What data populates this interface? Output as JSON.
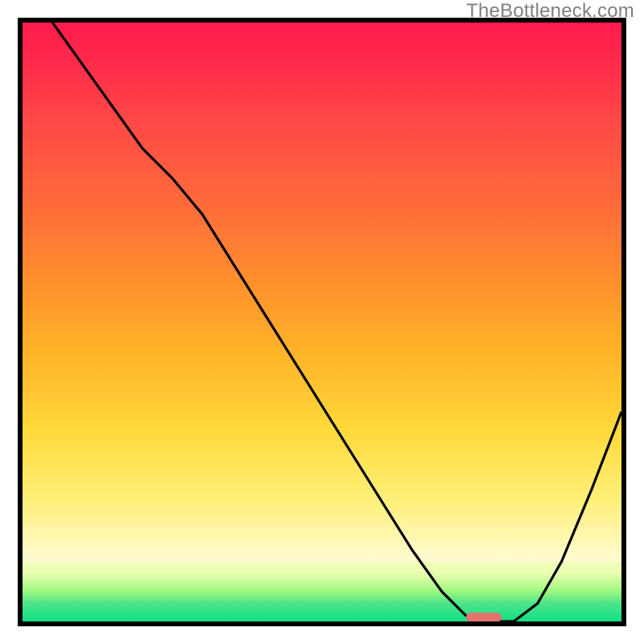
{
  "watermark": "TheBottleneck.com",
  "chart_data": {
    "type": "line",
    "title": "",
    "xlabel": "",
    "ylabel": "",
    "xlim": [
      0,
      100
    ],
    "ylim": [
      0,
      100
    ],
    "series": [
      {
        "name": "bottleneck-curve",
        "x": [
          5,
          10,
          15,
          20,
          25,
          30,
          40,
          50,
          60,
          65,
          70,
          74,
          78,
          82,
          86,
          90,
          95,
          100
        ],
        "y": [
          100,
          93,
          86,
          79,
          74,
          68,
          52,
          36,
          20,
          12,
          5,
          1,
          0,
          0,
          3,
          10,
          22,
          35
        ]
      }
    ],
    "marker": {
      "x": 77,
      "y": 0,
      "width_pct": 6,
      "color": "#e2736d"
    },
    "gradient_stops": [
      {
        "pos": 0,
        "color": "#ff1a4d"
      },
      {
        "pos": 30,
        "color": "#ff6a3a"
      },
      {
        "pos": 55,
        "color": "#ffb327"
      },
      {
        "pos": 80,
        "color": "#fff07a"
      },
      {
        "pos": 92,
        "color": "#e9ffb0"
      },
      {
        "pos": 100,
        "color": "#10e082"
      }
    ]
  }
}
